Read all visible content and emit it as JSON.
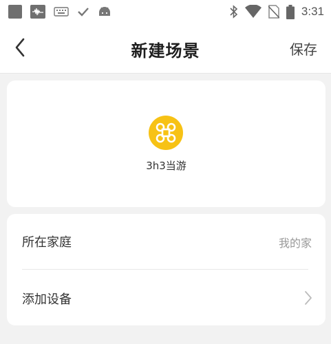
{
  "status_bar": {
    "time": "3:31",
    "icons": [
      "app-square-icon",
      "voice-recorder-icon",
      "keyboard-icon",
      "check-icon",
      "android-icon",
      "bluetooth-icon",
      "wifi-icon",
      "no-sim-icon",
      "battery-icon"
    ]
  },
  "header": {
    "title": "新建场景",
    "save_label": "保存",
    "back_icon": "chevron-left-icon"
  },
  "scene": {
    "name": "3h3当游",
    "icon": "command-icon",
    "icon_color": "#f7c215"
  },
  "settings": {
    "family_label": "所在家庭",
    "family_value": "我的家",
    "add_device_label": "添加设备"
  }
}
